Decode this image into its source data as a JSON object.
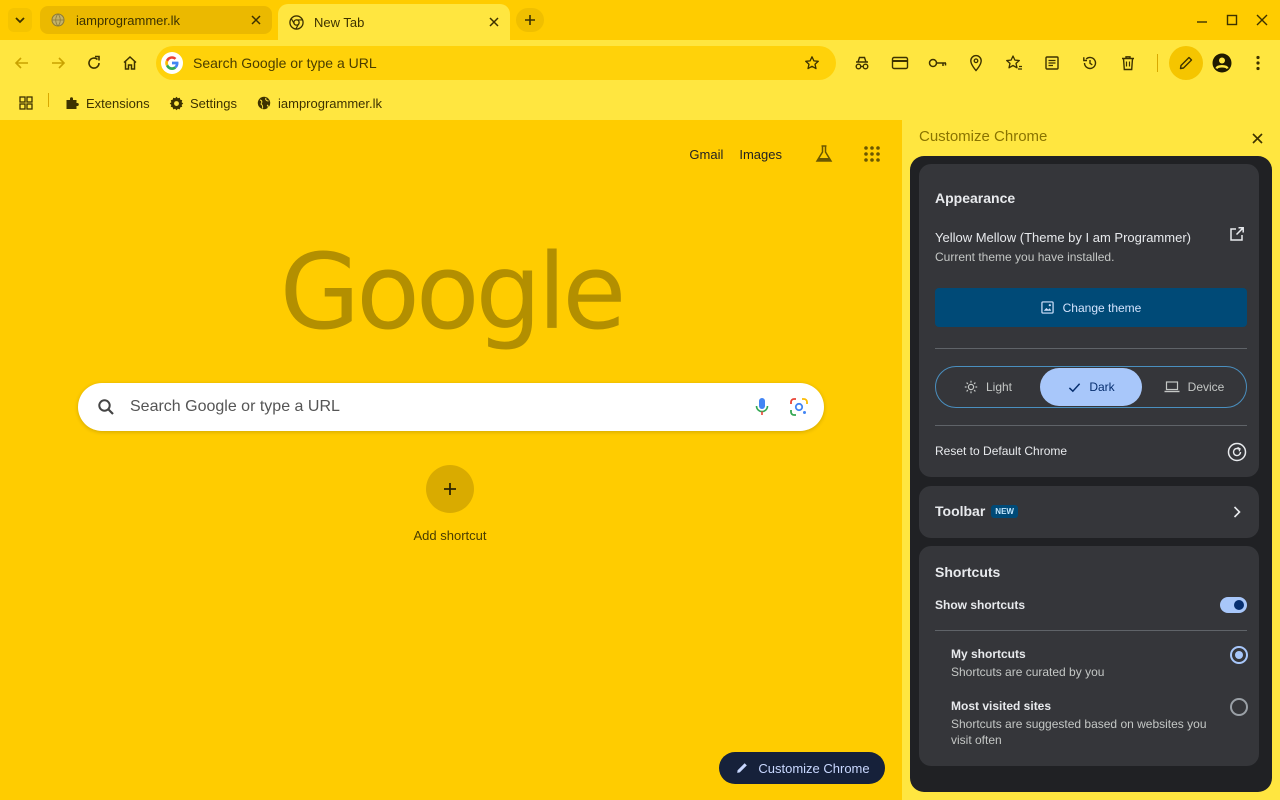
{
  "tabs": [
    {
      "title": "iamprogrammer.lk",
      "active": false
    },
    {
      "title": "New Tab",
      "active": true
    }
  ],
  "omnibox": {
    "placeholder": "Search Google or type a URL"
  },
  "bookmarks": [
    {
      "label": "Extensions",
      "icon": "puzzle-icon"
    },
    {
      "label": "Settings",
      "icon": "gear-icon"
    },
    {
      "label": "iamprogrammer.lk",
      "icon": "globe-icon"
    }
  ],
  "ntp": {
    "links": {
      "gmail": "Gmail",
      "images": "Images"
    },
    "logo": "Google",
    "search_placeholder": "Search Google or type a URL",
    "add_shortcut": "Add shortcut",
    "customize_button": "Customize Chrome"
  },
  "side_panel": {
    "title": "Customize Chrome",
    "appearance": {
      "heading": "Appearance",
      "theme_name": "Yellow Mellow (Theme by I am Programmer)",
      "theme_sub": "Current theme you have installed.",
      "change_theme": "Change theme",
      "modes": [
        "Light",
        "Dark",
        "Device"
      ],
      "selected_mode": "Dark",
      "reset": "Reset to Default Chrome"
    },
    "toolbar": {
      "heading": "Toolbar",
      "badge": "NEW"
    },
    "shortcuts": {
      "heading": "Shortcuts",
      "show_label": "Show shortcuts",
      "show_enabled": true,
      "options": [
        {
          "title": "My shortcuts",
          "sub": "Shortcuts are curated by you",
          "checked": true
        },
        {
          "title": "Most visited sites",
          "sub": "Shortcuts are suggested based on websites you visit often",
          "checked": false
        }
      ]
    }
  },
  "colors": {
    "theme_yellow": "#ffcc00",
    "toolbar_yellow": "#ffe640",
    "panel_dark": "#202124",
    "card_dark": "#35363a",
    "accent_blue": "#a8c7fa"
  }
}
